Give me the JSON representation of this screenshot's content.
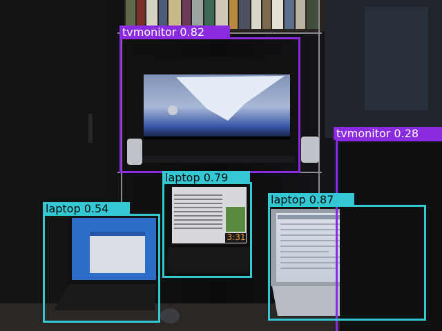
{
  "image": {
    "description_colors": {
      "tvmonitor": "#8a2be2",
      "laptop": "#33c8d4"
    }
  },
  "detections": [
    {
      "class": "tvmonitor",
      "score": "0.82",
      "text": "tvmonitor 0.82"
    },
    {
      "class": "tvmonitor",
      "score": "0.28",
      "text": "tvmonitor 0.28"
    },
    {
      "class": "laptop",
      "score": "0.79",
      "text": "laptop 0.79"
    },
    {
      "class": "laptop",
      "score": "0.54",
      "text": "laptop 0.54"
    },
    {
      "class": "laptop",
      "score": "0.87",
      "text": "laptop 0.87"
    }
  ],
  "scene_text": {
    "laptop_clock": "3:31"
  }
}
